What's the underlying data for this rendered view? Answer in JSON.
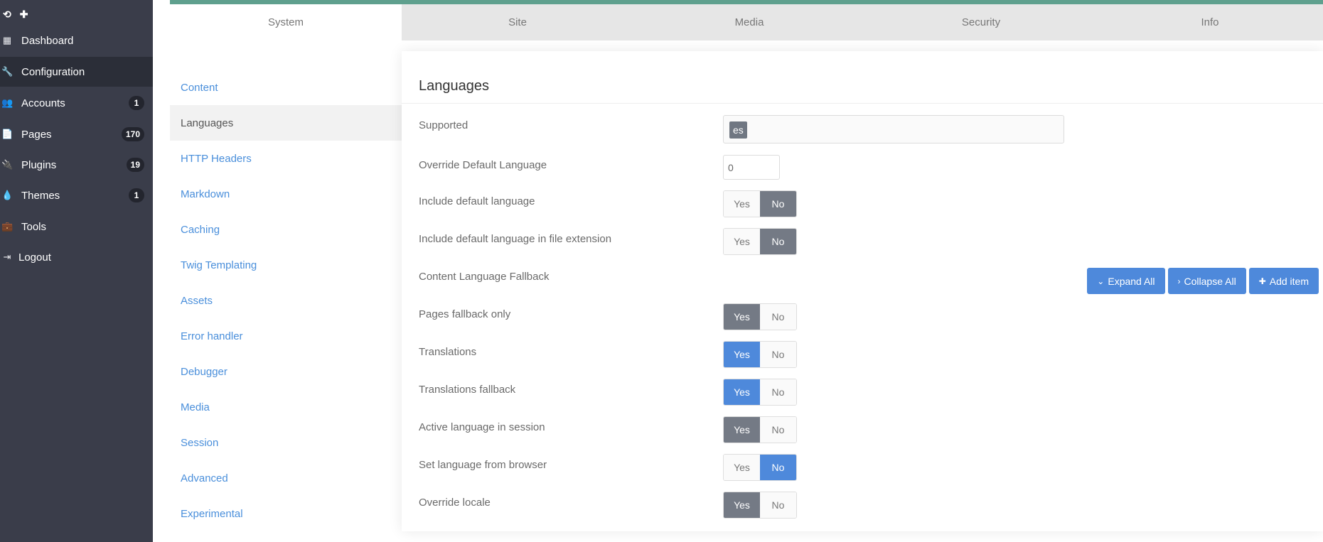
{
  "sidebar": {
    "top_icons": [
      "refresh-icon",
      "plus-icon"
    ],
    "items": [
      {
        "label": "Dashboard",
        "icon": "grid-icon",
        "badge": ""
      },
      {
        "label": "Configuration",
        "icon": "wrench-icon",
        "badge": "",
        "active": true
      },
      {
        "label": "Accounts",
        "icon": "users-icon",
        "badge": "1"
      },
      {
        "label": "Pages",
        "icon": "file-icon",
        "badge": "170"
      },
      {
        "label": "Plugins",
        "icon": "plug-icon",
        "badge": "19"
      },
      {
        "label": "Themes",
        "icon": "droplet-icon",
        "badge": "1"
      },
      {
        "label": "Tools",
        "icon": "briefcase-icon",
        "badge": ""
      },
      {
        "label": "Logout",
        "icon": "sign-out-icon",
        "badge": ""
      }
    ]
  },
  "tabs": [
    {
      "label": "System",
      "active": true
    },
    {
      "label": "Site"
    },
    {
      "label": "Media"
    },
    {
      "label": "Security"
    },
    {
      "label": "Info"
    }
  ],
  "subnav": [
    {
      "label": "Content"
    },
    {
      "label": "Languages",
      "active": true
    },
    {
      "label": "HTTP Headers"
    },
    {
      "label": "Markdown"
    },
    {
      "label": "Caching"
    },
    {
      "label": "Twig Templating"
    },
    {
      "label": "Assets"
    },
    {
      "label": "Error handler"
    },
    {
      "label": "Debugger"
    },
    {
      "label": "Media"
    },
    {
      "label": "Session"
    },
    {
      "label": "Advanced"
    },
    {
      "label": "Experimental"
    }
  ],
  "panel": {
    "title": "Languages",
    "supported": {
      "label": "Supported",
      "tag": "es"
    },
    "override_default": {
      "label": "Override Default Language",
      "value": "0"
    },
    "toggles": [
      {
        "label": "Include default language",
        "yes": "Yes",
        "no": "No",
        "selected": "no",
        "style": "dark"
      },
      {
        "label": "Include default language in file extension",
        "yes": "Yes",
        "no": "No",
        "selected": "no",
        "style": "dark"
      },
      {
        "label": "Pages fallback only",
        "yes": "Yes",
        "no": "No",
        "selected": "yes",
        "style": "dark"
      },
      {
        "label": "Translations",
        "yes": "Yes",
        "no": "No",
        "selected": "yes",
        "style": "blue"
      },
      {
        "label": "Translations fallback",
        "yes": "Yes",
        "no": "No",
        "selected": "yes",
        "style": "blue"
      },
      {
        "label": "Active language in session",
        "yes": "Yes",
        "no": "No",
        "selected": "yes",
        "style": "dark"
      },
      {
        "label": "Set language from browser",
        "yes": "Yes",
        "no": "No",
        "selected": "no",
        "style": "blue"
      },
      {
        "label": "Override locale",
        "yes": "Yes",
        "no": "No",
        "selected": "yes",
        "style": "dark"
      }
    ],
    "fallback": {
      "label": "Content Language Fallback",
      "expand_all": "Expand All",
      "collapse_all": "Collapse All",
      "add_item": "Add item"
    }
  },
  "colors": {
    "sidebar_bg": "#3a3d4a",
    "accent": "#5fa08e",
    "link": "#4a8fdb",
    "primary": "#4e89db",
    "toggle_dark": "#747a85"
  }
}
